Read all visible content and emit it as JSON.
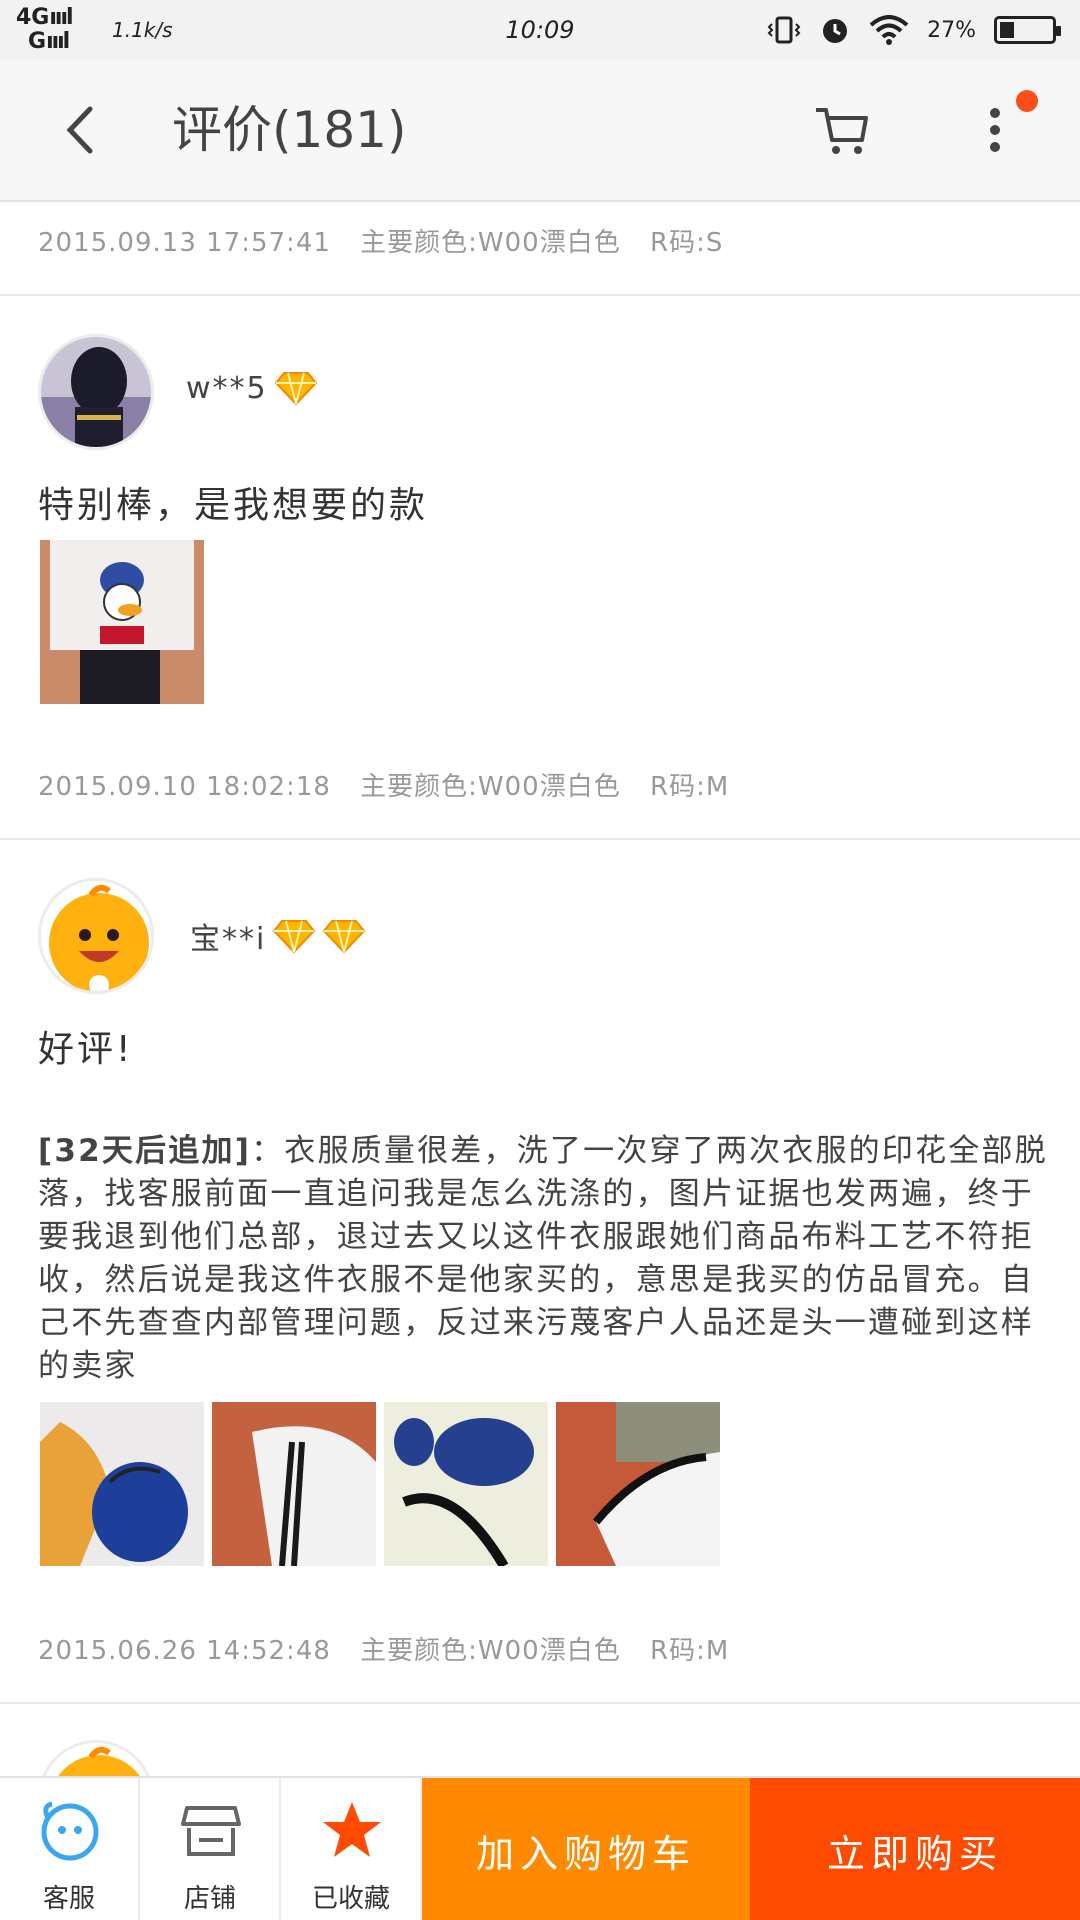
{
  "status_bar": {
    "signal": "4G",
    "signal2": "G",
    "net_speed": "1.1k/s",
    "time": "10:09",
    "battery": "27%",
    "battery_level": 0.27
  },
  "header": {
    "title": "评价(181)",
    "back_icon": "back-arrow-icon",
    "cart_icon": "cart-icon",
    "more_icon": "more-vertical-icon",
    "notify_color": "#ff4e1a"
  },
  "reviews": [
    {
      "date": "2015.09.13 17:57:41",
      "color": "主要颜色:W00漂白色",
      "size": "R码:S"
    },
    {
      "user": "w**5",
      "diamonds": 1,
      "text": "特别棒，是我想要的款",
      "date": "2015.09.10 18:02:18",
      "color": "主要颜色:W00漂白色",
      "size": "R码:M"
    },
    {
      "user": "宝**i",
      "diamonds": 2,
      "text": "好评!",
      "append_label": "[32天后追加]",
      "append_text": "：衣服质量很差，洗了一次穿了两次衣服的印花全部脱落，找客服前面一直追问我是怎么洗涤的，图片证据也发两遍，终于要我退到他们总部，退过去又以这件衣服跟她们商品布料工艺不符拒收，然后说是我这件衣服不是他家买的，意思是我买的仿品冒充。自己不先查查内部管理问题，反过来污蔑客户人品还是头一遭碰到这样的卖家",
      "date": "2015.06.26 14:52:48",
      "color": "主要颜色:W00漂白色",
      "size": "R码:M"
    }
  ],
  "bottom_bar": {
    "service_label": "客服",
    "shop_label": "店铺",
    "favorite_label": "已收藏",
    "add_cart_label": "加入购物车",
    "buy_now_label": "立即购买",
    "add_cart_color": "#ff8a00",
    "buy_now_color": "#ff4b00"
  }
}
